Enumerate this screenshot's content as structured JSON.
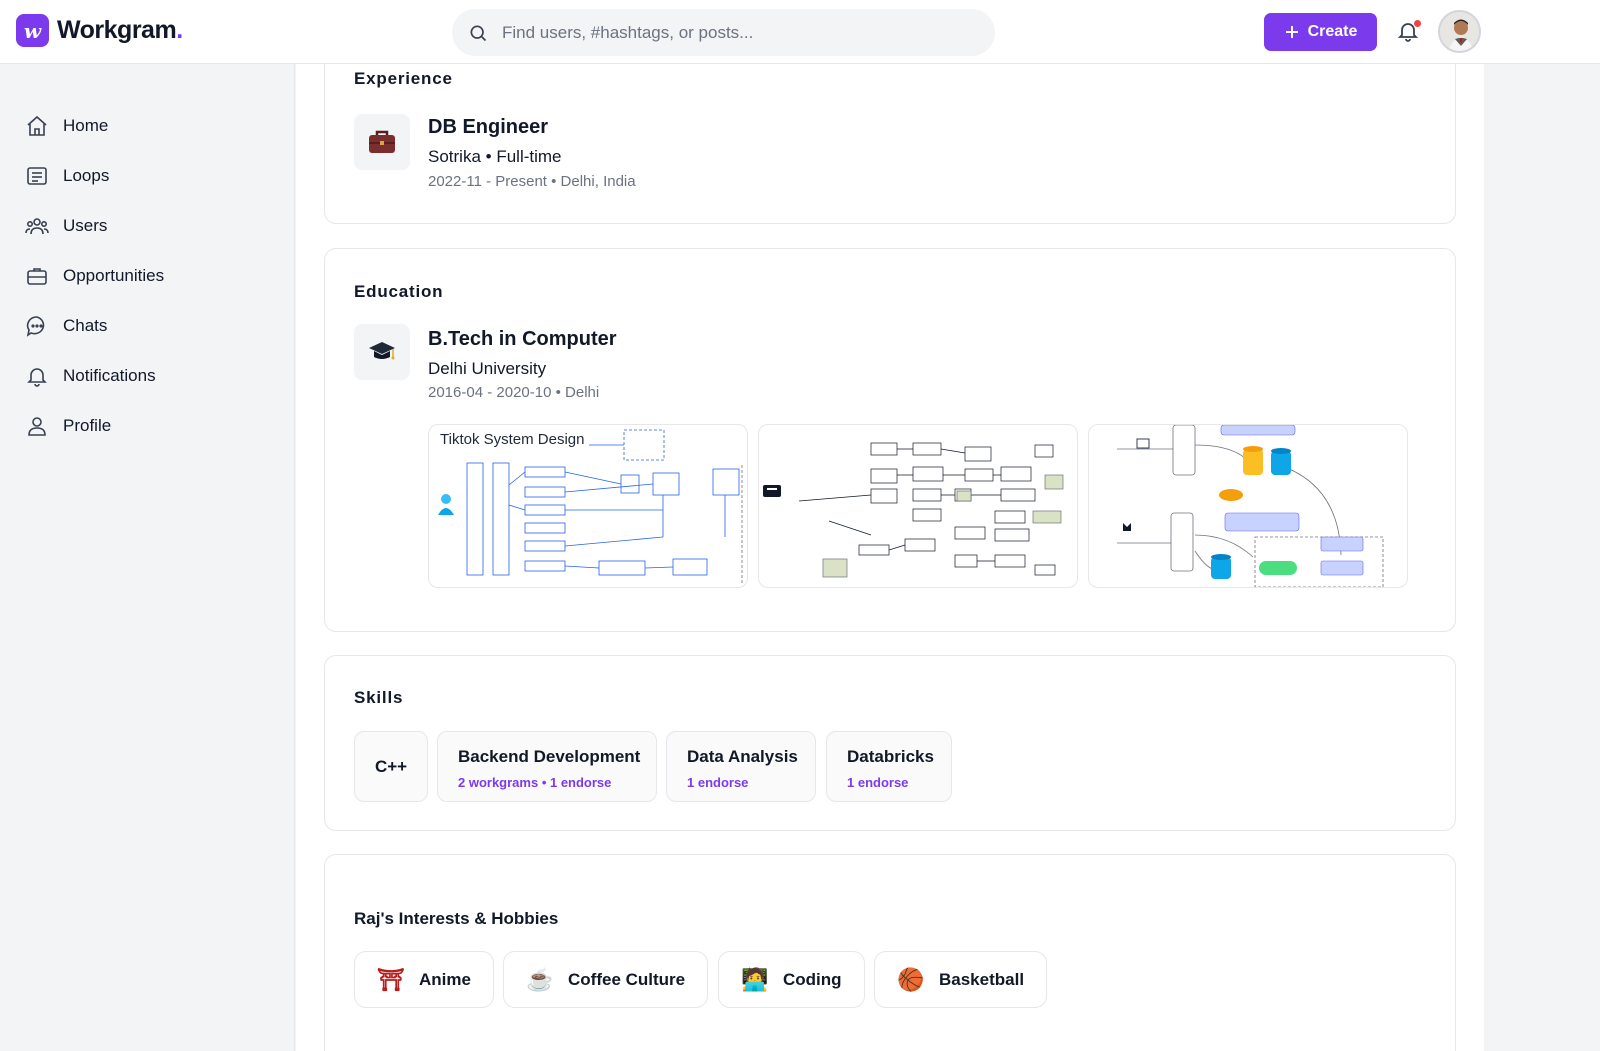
{
  "app": {
    "name": "Workgram",
    "logo_letter": "w",
    "logo_dot": "."
  },
  "search": {
    "placeholder": "Find users, #hashtags, or posts..."
  },
  "header": {
    "create_label": "Create"
  },
  "colors": {
    "accent": "#7c3aed",
    "notification_dot": "#ef4444"
  },
  "nav": [
    {
      "label": "Home",
      "icon": "home-icon"
    },
    {
      "label": "Loops",
      "icon": "loops-icon"
    },
    {
      "label": "Users",
      "icon": "users-icon"
    },
    {
      "label": "Opportunities",
      "icon": "briefcase-icon"
    },
    {
      "label": "Chats",
      "icon": "chat-icon"
    },
    {
      "label": "Notifications",
      "icon": "bell-icon"
    },
    {
      "label": "Profile",
      "icon": "user-icon"
    }
  ],
  "experience": {
    "title": "Experience",
    "icon": "briefcase-icon",
    "role": "DB Engineer",
    "company": "Sotrika",
    "employment_type": "Full-time",
    "meta": "2022-11 - Present • Delhi, India"
  },
  "education": {
    "title": "Education",
    "icon": "graduation-cap-icon",
    "degree": "B.Tech in Computer",
    "school": "Delhi University",
    "meta": "2016-04 - 2020-10 • Delhi",
    "attachment_caption": "Tiktok System Design"
  },
  "skills": {
    "title": "Skills",
    "items": [
      {
        "name": "C++",
        "meta": ""
      },
      {
        "name": "Backend Development",
        "meta": "2 workgrams • 1 endorse"
      },
      {
        "name": "Data Analysis",
        "meta": "1 endorse"
      },
      {
        "name": "Databricks",
        "meta": "1 endorse"
      }
    ]
  },
  "interests": {
    "title": "Raj's Interests & Hobbies",
    "items": [
      {
        "label": "Anime",
        "emoji": "⛩"
      },
      {
        "label": "Coffee Culture",
        "emoji": "☕"
      },
      {
        "label": "Coding",
        "emoji": "🧑‍💻"
      },
      {
        "label": "Basketball",
        "emoji": "🏀"
      }
    ]
  }
}
